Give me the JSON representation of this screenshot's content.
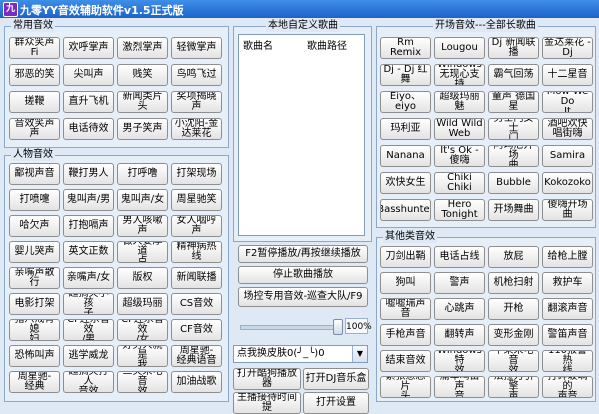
{
  "window": {
    "title": "九零YY音效辅助软件v1.5正式版",
    "app_icon": "九"
  },
  "common": {
    "title": "常用音效",
    "buttons": [
      "群众笑声Fi",
      "欢呼掌声",
      "激烈掌声",
      "轻微掌声",
      "邪恶的笑",
      "尖叫声",
      "贱笑",
      "鸟鸣飞过",
      "搓鞭",
      "直升飞机",
      "新闻类片头",
      "奖项揭晓声",
      "音效笑声\n声",
      "电话待效",
      "男子笑声",
      "小沈阳-金\n达莱花"
    ]
  },
  "people": {
    "title": "人物音效",
    "buttons": [
      "鄙视声音",
      "鞭打男人",
      "打呼噜",
      "打架现场",
      "打喷嚏",
      "鬼叫声/男",
      "鬼叫声/女",
      "周星驰笑",
      "哈欠声",
      "打抱嗝声",
      "男人咳嗽声",
      "女人咽哼声",
      "婴儿哭声",
      "英文正数",
      "做人要厚道\n点",
      "精神病热线",
      "亲嘴声散行",
      "亲嘴声/女",
      "版权",
      "新闻联播",
      "电影打架",
      "超搞笑小孩\n子",
      "超级玛丽",
      "CS音效",
      "猪八戒背媳\n妇",
      "CF连杀音效\n/男",
      "CF连杀音效\n/女",
      "CF音效",
      "恐怖叫声",
      "逃学威龙",
      "好男人就是\n我",
      "周星驰-\n经典语音",
      "周星驰-\n经典",
      "超搞笑打人\n音效",
      "三笑来电音\n效",
      "加油战歌"
    ]
  },
  "custom": {
    "title": "本地自定义歌曲",
    "col_name": "歌曲名",
    "col_path": "歌曲路径",
    "f2_label": "F2暂停播放/再按继续播放",
    "stop_label": "停止歌曲播放",
    "venue_label": "场控专用音效-巡查大队/F9",
    "volume": "100%",
    "combo_value": "点我换皮肤0(╯_╰)0",
    "cool_label": "打开酷狗播放器",
    "dj_label": "打开DJ音乐盒",
    "more1": "主播接待时间提",
    "more2": "打开设置"
  },
  "opening": {
    "title": "开场音效---全部长歌曲",
    "buttons": [
      "Rm Remix",
      "Lougou",
      "Dj 新闻联\n播",
      "金达莱花 -\nDj",
      "Dj - Dj 红\n舞",
      "Windows\n无现心支持",
      "霸气回荡",
      "十二星音",
      "Eiyo、eiyo",
      "超级玛丽魅",
      "童声 德国\n星",
      "Mow We Do\nIt",
      "玛利亚",
      "Wild Wild\nWeb",
      "男士门女士\n门",
      "酒吧欢快\n唱街嗨",
      "Nanana",
      "It's Ok -\n傻嗨",
      "阿玛尼开场\n曲",
      "Samira",
      "欢快女生",
      "Chiki\nChiki",
      "Bubble",
      "Kokozoko",
      "Basshunter",
      "Hero\nTonight",
      "开场舞曲",
      "傻嗨开场曲"
    ]
  },
  "other": {
    "title": "其他类音效",
    "buttons": [
      "刀剑出鞘",
      "电话占线",
      "放屁",
      "给枪上膛",
      "狗叫",
      "警声",
      "机枪扫射",
      "救护车",
      "嘘嘘瑞声音",
      "心跳声",
      "开枪",
      "翻滚声音",
      "手枪声音",
      "翻转声",
      "变形金刚",
      "警笛声音",
      "结束音效",
      "Windows特\n效",
      "苹果来电音\n效",
      "110报警热\n线",
      "紧张悬念片\n头",
      "痛车鸣笛声\n音",
      "法拉力引擎\n声",
      "打碎玻璃的\n声音"
    ]
  }
}
